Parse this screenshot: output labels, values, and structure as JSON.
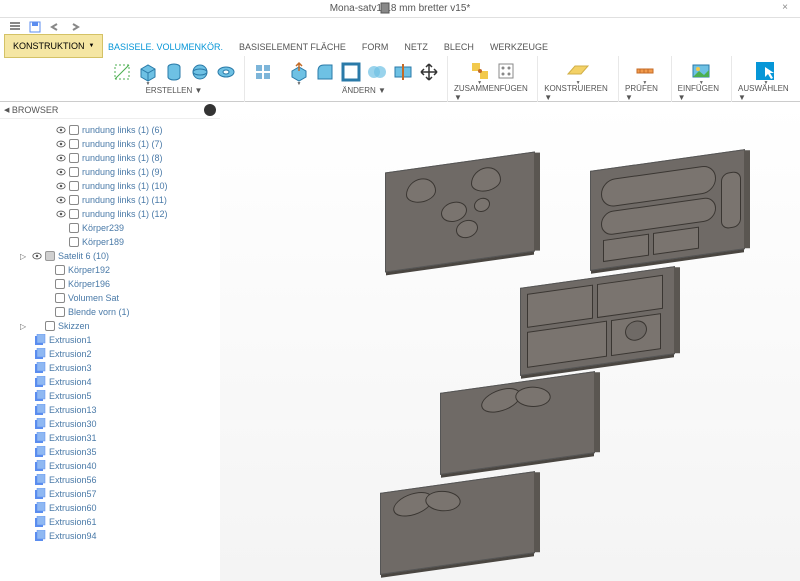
{
  "title": "Mona-satv1-18 mm bretter v15*",
  "construct": "KONSTRUKTION",
  "tabs": {
    "basis": "BASISELE. VOLUMENKÖR.",
    "fläche": "BASISELEMENT FLÄCHE",
    "form": "FORM",
    "netz": "NETZ",
    "blech": "BLECH",
    "werk": "WERKZEUGE"
  },
  "ribbon": {
    "erstellen": "ERSTELLEN ▼",
    "ändern": "ÄNDERN ▼",
    "zusammen": "ZUSAMMENFÜGEN ▼",
    "konstr": "KONSTRUIEREN ▼",
    "prüfen": "PRÜFEN ▼",
    "einfügen": "EINFÜGEN ▼",
    "auswählen": "AUSWÄHLEN ▼"
  },
  "browser": {
    "label": "BROWSER",
    "items": [
      {
        "type": "body",
        "label": "rundung links (1) (6)"
      },
      {
        "type": "body",
        "label": "rundung links (1) (7)"
      },
      {
        "type": "body",
        "label": "rundung links (1) (8)"
      },
      {
        "type": "body",
        "label": "rundung links (1) (9)"
      },
      {
        "type": "body",
        "label": "rundung links (1) (10)"
      },
      {
        "type": "body",
        "label": "rundung links (1) (11)"
      },
      {
        "type": "body",
        "label": "rundung links (1) (12)"
      },
      {
        "type": "body",
        "label": "Körper239",
        "novis": true
      },
      {
        "type": "body",
        "label": "Körper189",
        "novis": true
      },
      {
        "type": "folder",
        "label": "Satelit 6 (10)",
        "expand": true
      },
      {
        "type": "body",
        "label": "Körper192",
        "novis": true
      },
      {
        "type": "body",
        "label": "Körper196",
        "novis": true
      },
      {
        "type": "body",
        "label": "Volumen Sat",
        "novis": true
      },
      {
        "type": "body",
        "label": "Blende vorn (1)",
        "novis": true
      },
      {
        "type": "skizzen",
        "label": "Skizzen",
        "expand": true
      }
    ],
    "ext": [
      "Extrusion1",
      "Extrusion2",
      "Extrusion3",
      "Extrusion4",
      "Extrusion5",
      "Extrusion13",
      "Extrusion30",
      "Extrusion31",
      "Extrusion35",
      "Extrusion40",
      "Extrusion56",
      "Extrusion57",
      "Extrusion60",
      "Extrusion61",
      "Extrusion94"
    ]
  }
}
